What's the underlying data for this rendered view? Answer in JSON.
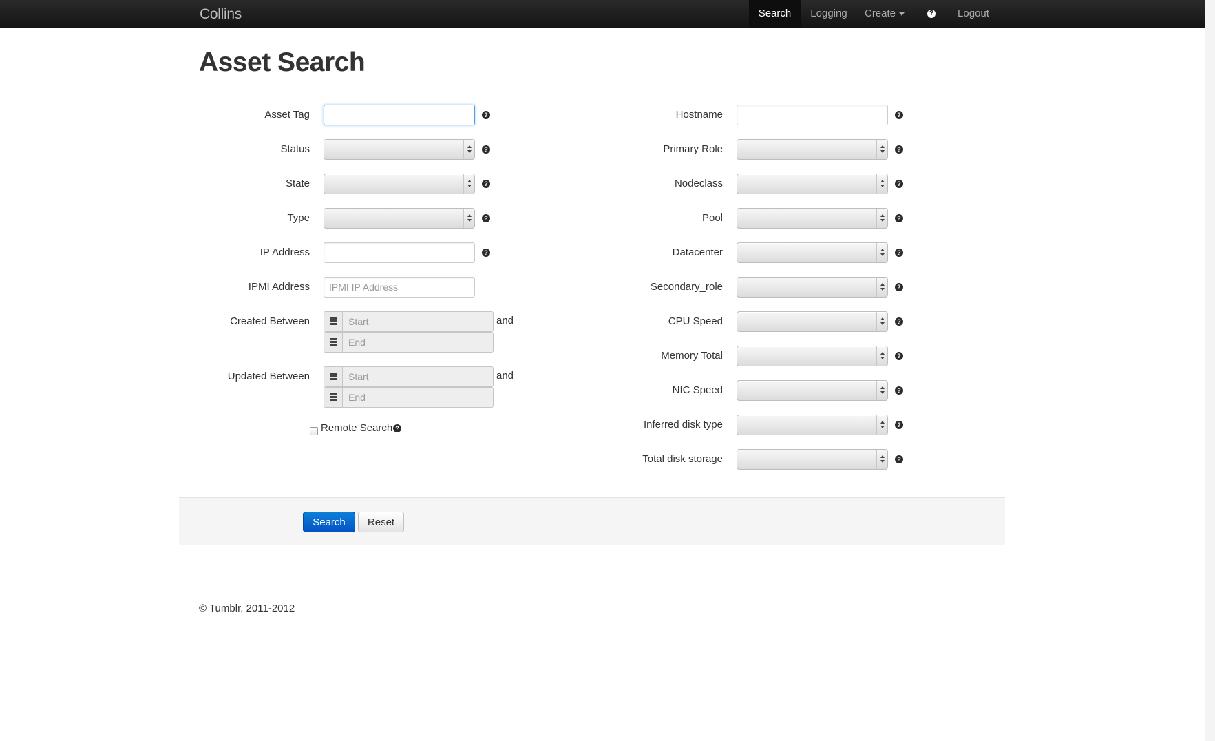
{
  "nav": {
    "brand": "Collins",
    "items": [
      {
        "label": "Search",
        "active": true
      },
      {
        "label": "Logging"
      },
      {
        "label": "Create"
      },
      {
        "label": "?"
      },
      {
        "label": "Logout"
      }
    ],
    "help_icon": "question-circle-icon"
  },
  "page": {
    "title": "Asset Search"
  },
  "form": {
    "left": {
      "asset_tag": {
        "label": "Asset Tag",
        "value": ""
      },
      "status": {
        "label": "Status",
        "value": ""
      },
      "state": {
        "label": "State",
        "value": ""
      },
      "type": {
        "label": "Type",
        "value": ""
      },
      "ip_address": {
        "label": "IP Address",
        "value": ""
      },
      "ipmi_address": {
        "label": "IPMI Address",
        "placeholder": "IPMI IP Address",
        "value": ""
      },
      "created_between": {
        "label": "Created Between",
        "start_placeholder": "Start",
        "end_placeholder": "End",
        "and": "and"
      },
      "updated_between": {
        "label": "Updated Between",
        "start_placeholder": "Start",
        "end_placeholder": "End",
        "and": "and"
      },
      "remote_search": {
        "label": "Remote Search",
        "checked": false
      }
    },
    "right": {
      "hostname": {
        "label": "Hostname",
        "value": ""
      },
      "primary_role": {
        "label": "Primary Role",
        "value": ""
      },
      "nodeclass": {
        "label": "Nodeclass",
        "value": ""
      },
      "pool": {
        "label": "Pool",
        "value": ""
      },
      "datacenter": {
        "label": "Datacenter",
        "value": ""
      },
      "secondary_role": {
        "label": "Secondary_role",
        "value": ""
      },
      "cpu_speed": {
        "label": "CPU Speed",
        "value": ""
      },
      "memory_total": {
        "label": "Memory Total",
        "value": ""
      },
      "nic_speed": {
        "label": "NIC Speed",
        "value": ""
      },
      "inferred_disk_type": {
        "label": "Inferred disk type",
        "value": ""
      },
      "total_disk_storage": {
        "label": "Total disk storage",
        "value": ""
      }
    },
    "help_glyph": "?"
  },
  "actions": {
    "search_label": "Search",
    "reset_label": "Reset"
  },
  "footer": {
    "text": "© Tumblr, 2011-2012"
  },
  "colors": {
    "primary_button": "#0553c4",
    "navbar": "#1b1b1b",
    "focus_border": "#5d9fdc"
  }
}
